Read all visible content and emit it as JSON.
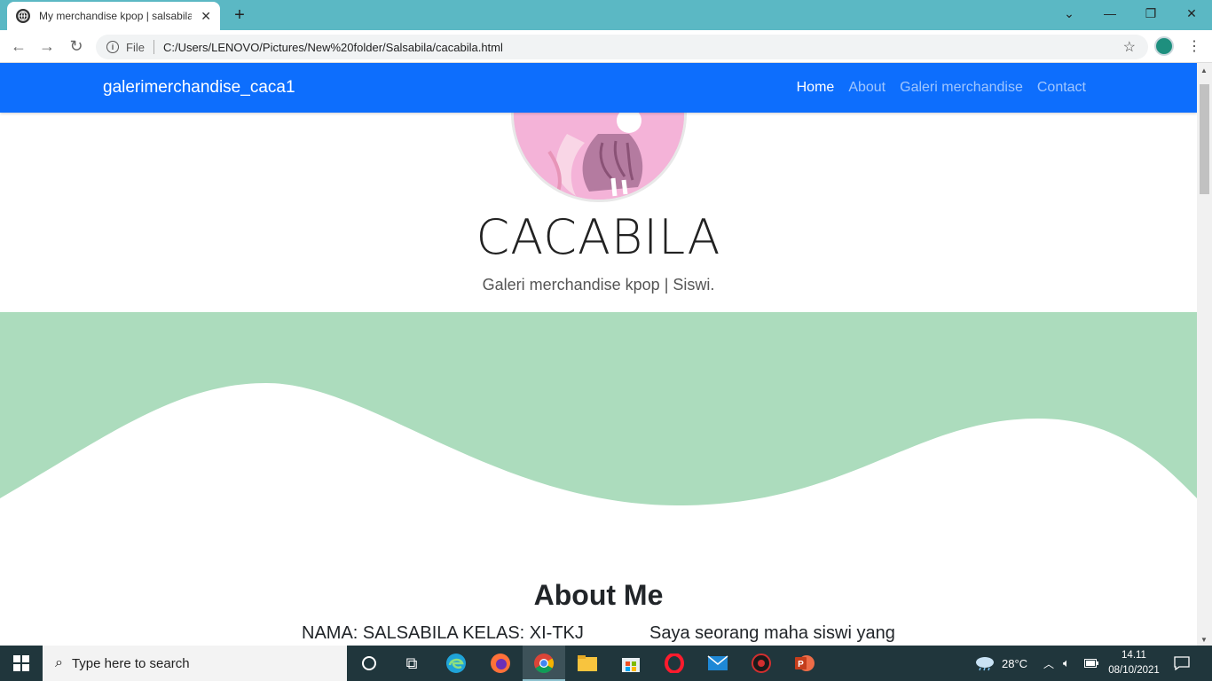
{
  "browser": {
    "tab_title": "My merchandise kpop | salsabila!",
    "tab_close": "✕",
    "new_tab": "+",
    "file_label": "File",
    "url": "C:/Users/LENOVO/Pictures/New%20folder/Salsabila/cacabila.html"
  },
  "navbar": {
    "brand": "galerimerchandise_caca1",
    "links": [
      "Home",
      "About",
      "Galeri merchandise",
      "Contact"
    ],
    "active_index": 0
  },
  "hero": {
    "title": "CACABILA",
    "subtitle": "Galeri merchandise kpop | Siswi."
  },
  "about": {
    "title": "About Me",
    "left_text": "NAMA: SALSABILA KELAS: XI-TKJ",
    "right_text": "Saya seorang maha siswi yang"
  },
  "taskbar": {
    "search_placeholder": "Type here to search",
    "weather": "28°C",
    "time": "14.11",
    "date": "08/10/2021"
  },
  "colors": {
    "navbar": "#0d6efd",
    "wave": "#acdcbd",
    "tabstrip": "#5bb8c4",
    "taskbar": "#20363c"
  }
}
